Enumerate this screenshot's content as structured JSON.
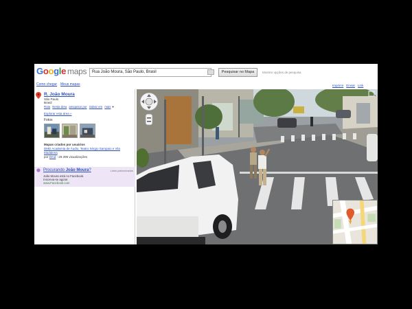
{
  "brand": {
    "google": [
      "G",
      "o",
      "o",
      "g",
      "l",
      "e"
    ],
    "maps": "maps"
  },
  "search": {
    "value": "Rua João Moura, São Paulo, Brasil",
    "button_label": "Pesquisar no Mapa",
    "options_link": "Mostrar opções de pesquisa"
  },
  "nav": {
    "links": [
      "Como chegar",
      "Meus mapas"
    ]
  },
  "top_links": [
    "Imprimir",
    "Enviar",
    "Link"
  ],
  "result": {
    "title": "R. João Moura",
    "locality": "São Paulo",
    "country": "Brasil",
    "links": [
      "Rota",
      "Nesta área",
      "pesquisar por",
      "Salvar em",
      "mais"
    ],
    "more_symbol": "▾",
    "explore": "Explorar esta área »",
    "photos_label": "Fotos",
    "user_maps": {
      "heading": "Mapas criados por usuários",
      "item_line1": "DMD Academia de Áudio, Teatro Sérgio Sampaio e Vila",
      "item_line2": "Madalena",
      "by_prefix": "por",
      "by_user": "Dmd",
      "by_suffix": "- 29.395 visualizações"
    }
  },
  "ad": {
    "title_prefix": "Procurando",
    "title_name": "João Moura",
    "title_suffix": "?",
    "label": "Links patrocinados",
    "line1": "João Moura está no Facebook.",
    "line2": "Inscreva-se agora!",
    "url": "www.Facebook.com"
  },
  "colors": {
    "link": "#2a4fbd",
    "pin": "#d9472b",
    "ad_bg": "#eee6f6"
  }
}
